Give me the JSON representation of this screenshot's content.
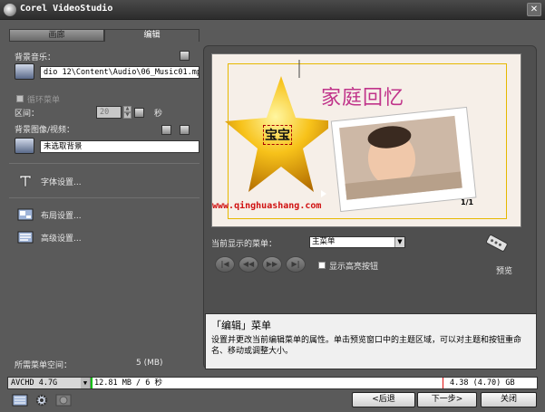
{
  "window": {
    "title": "Corel VideoStudio",
    "close_glyph": "✕"
  },
  "tabs": [
    {
      "label": "画廊"
    },
    {
      "label": "编辑"
    }
  ],
  "background_music": {
    "label": "背景音乐：",
    "path": "dio 12\\Content\\Audio\\06_Music01.mpa",
    "icon": "music-folder-icon"
  },
  "loop_checkbox": {
    "label": "循环菜单"
  },
  "interval": {
    "label": "区间：",
    "value": "20",
    "unit": "秒"
  },
  "background_media": {
    "label": "背景图像/视频：",
    "value": "未选取背景",
    "icon": "image-folder-icon"
  },
  "tools": {
    "font_settings": "字体设置...",
    "layout_settings": "布局设置...",
    "advanced_settings": "高级设置..."
  },
  "menu_space": {
    "label": "所需菜单空间：",
    "value": "5 (MB)"
  },
  "preview": {
    "title": "家庭回忆",
    "item_label": "宝宝",
    "page_counter": "1/1",
    "watermark": "www.qinghuashang.com"
  },
  "menu_select": {
    "label": "当前显示的菜单：",
    "value": "主菜单"
  },
  "highlight_checkbox": {
    "label": "显示高亮按钮"
  },
  "preview_button": {
    "label": "预览"
  },
  "description": {
    "title": "「编辑」菜单",
    "text": "设置并更改当前编辑菜单的属性。单击预览窗口中的主题区域，可以对主题和按钮重命名、移动或调整大小。"
  },
  "status": {
    "format": "AVCHD 4.7G",
    "used": "12.81 MB / 6 秒",
    "free": "4.38 (4.70) GB",
    "usage_fraction": 0.003,
    "accent": "#00c000"
  },
  "buttons": {
    "back": "<后退",
    "next": "下一步>",
    "close": "关闭"
  }
}
